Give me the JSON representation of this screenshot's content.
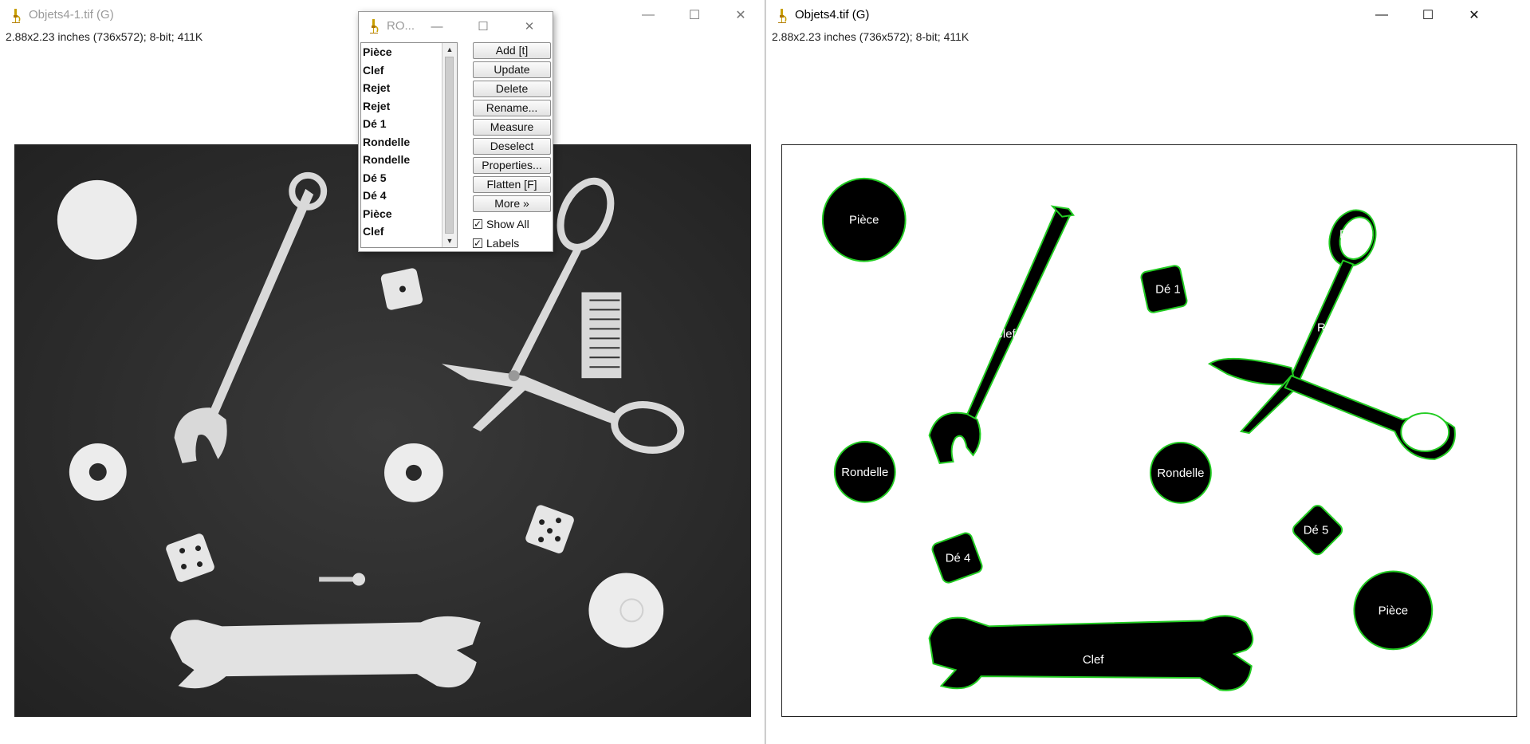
{
  "left_window": {
    "title": "Objets4-1.tif (G)",
    "info": "2.88x2.23 inches (736x572); 8-bit; 411K",
    "controls": {
      "minimize": "—",
      "maximize": "☐",
      "close": "✕"
    }
  },
  "right_window": {
    "title": "Objets4.tif (G)",
    "info": "2.88x2.23 inches (736x572); 8-bit; 411K",
    "controls": {
      "minimize": "—",
      "maximize": "☐",
      "close": "✕"
    },
    "overlay_labels": {
      "piece_top": "Pièce",
      "clef_long": "Clef",
      "rejet_top": "Rejet",
      "rejet_mid": "Rejet",
      "de1": "Dé 1",
      "rondelle_left": "Rondelle",
      "rondelle_mid": "Rondelle",
      "de5": "Dé 5",
      "de4": "Dé 4",
      "piece_bottom": "Pièce",
      "clef_bottom": "Clef"
    }
  },
  "roi_manager": {
    "title": "RO...",
    "controls": {
      "minimize": "—",
      "maximize": "☐",
      "close": "✕"
    },
    "items": [
      "Pièce",
      "Clef",
      "Rejet",
      "Rejet",
      "Dé 1",
      "Rondelle",
      "Rondelle",
      "Dé 5",
      "Dé 4",
      "Pièce",
      "Clef"
    ],
    "buttons": {
      "add": "Add [t]",
      "update": "Update",
      "delete": "Delete",
      "rename": "Rename...",
      "measure": "Measure",
      "deselect": "Deselect",
      "properties": "Properties...",
      "flatten": "Flatten [F]",
      "more": "More »"
    },
    "checkboxes": {
      "show_all": {
        "label": "Show All",
        "checked": true
      },
      "labels": {
        "label": "Labels",
        "checked": true
      }
    }
  },
  "colors": {
    "image_background": "#2c2c2c",
    "object_fill_light": "#e6e6e6",
    "mask_fill": "#000000",
    "outline": "#22cc22"
  }
}
